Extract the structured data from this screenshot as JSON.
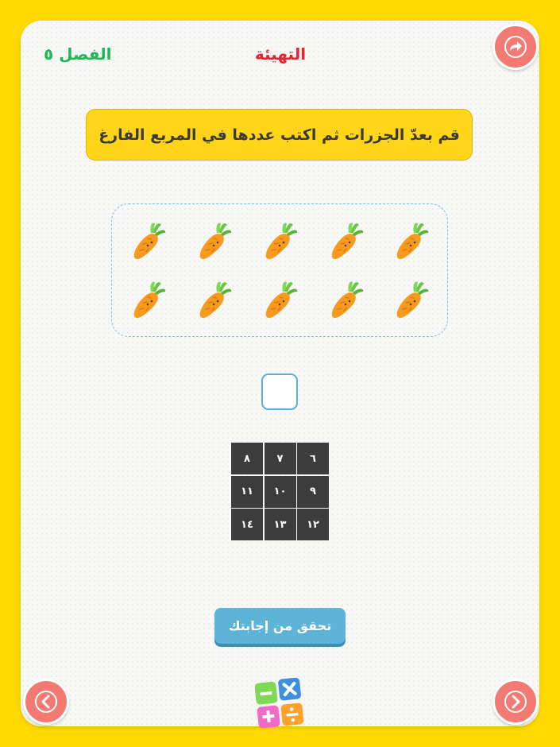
{
  "header": {
    "chapter_label": "الفصل ٥",
    "title": "التهيئة"
  },
  "instruction": "قم بعدّ الجزرات ثم اكتب عددها في المربع الفارغ",
  "carrots": {
    "count": 10,
    "icon": "carrot-icon"
  },
  "answer": {
    "value": ""
  },
  "number_grid": [
    "٦",
    "٧",
    "٨",
    "٩",
    "١٠",
    "١١",
    "١٢",
    "١٣",
    "١٤"
  ],
  "check_button_label": "تحقق من إجابتك",
  "colors": {
    "background": "#FFD900",
    "chapter_green": "#1DB954",
    "title_red": "#E8232F",
    "nav_button": "#F37A72",
    "check_button": "#5EB3D9",
    "instruction_bg": "#FFD51A"
  },
  "icons": {
    "forward": "share-forward-icon",
    "previous": "chevron-left-icon",
    "next": "chevron-right-icon",
    "logo": "math-operations-logo"
  }
}
